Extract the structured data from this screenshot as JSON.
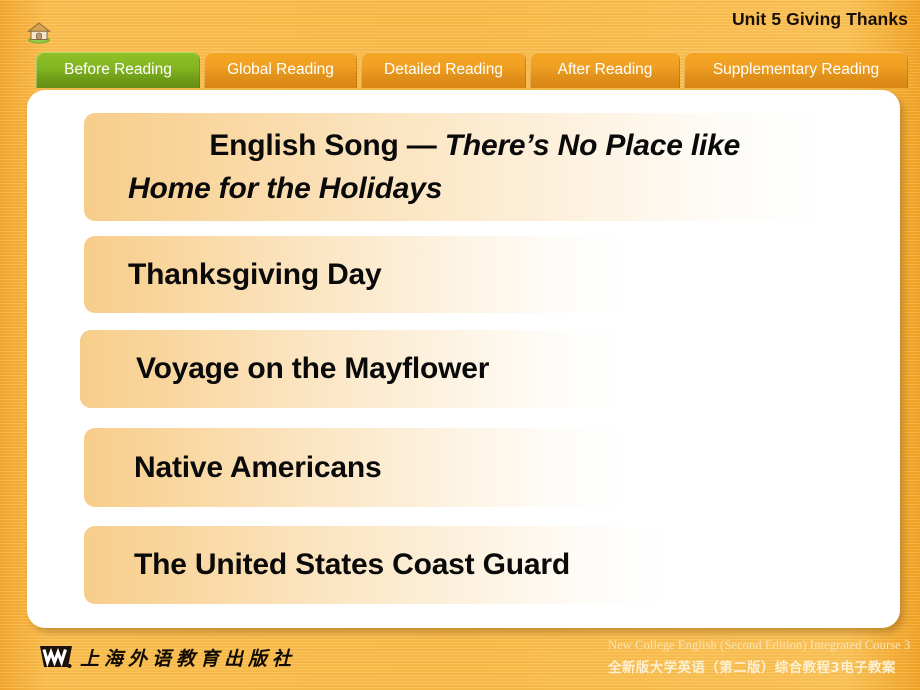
{
  "header": {
    "title": "Unit 5 Giving Thanks",
    "home_icon": "home-icon"
  },
  "tabs": [
    {
      "label": "Before Reading",
      "active": true
    },
    {
      "label": "Global Reading",
      "active": false
    },
    {
      "label": "Detailed Reading",
      "active": false
    },
    {
      "label": "After Reading",
      "active": false
    },
    {
      "label": "Supplementary Reading",
      "active": false
    }
  ],
  "content": {
    "items": [
      {
        "prefix": "English Song — ",
        "italic": "There’s No Place like Home for the Holidays"
      },
      {
        "prefix": "Thanksgiving Day",
        "italic": ""
      },
      {
        "prefix": "Voyage on the Mayflower",
        "italic": ""
      },
      {
        "prefix": "Native Americans",
        "italic": ""
      },
      {
        "prefix": "The United States Coast Guard",
        "italic": ""
      }
    ]
  },
  "footer": {
    "publisher_cn": "上海外语教育出版社",
    "course_en": "New College English (Second Edition) Integrated Course 3",
    "course_cn": "全新版大学英语（第二版）综合教程3电子教案"
  },
  "colors": {
    "background_orange": "#f9b63f",
    "tab_active_green": "#82b522",
    "tab_inactive_orange": "#efa022",
    "panel_white": "#ffffff",
    "pill_start": "#f7cd8a",
    "pill_end": "#ffffff",
    "title_text": "#181008"
  }
}
